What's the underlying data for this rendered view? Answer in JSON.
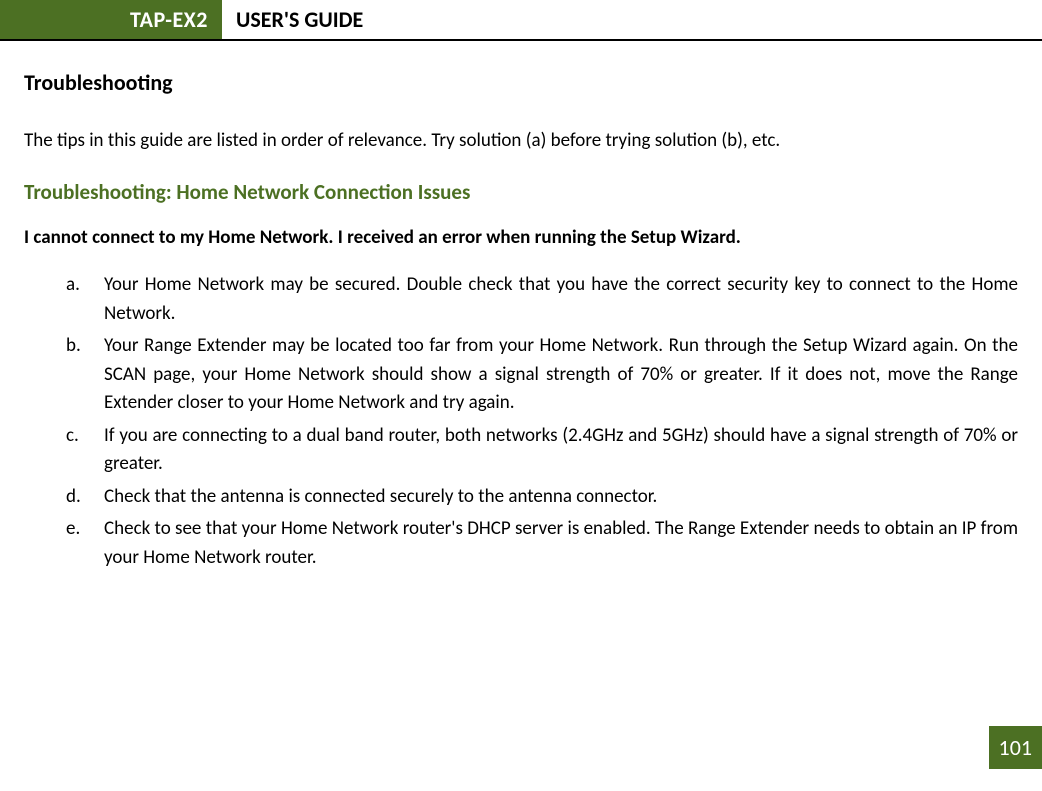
{
  "header": {
    "product": "TAP-EX2",
    "title": "USER'S GUIDE"
  },
  "page": {
    "heading": "Troubleshooting",
    "intro": "The tips in this guide are listed in order of relevance. Try solution (a) before trying solution (b), etc.",
    "subheading": "Troubleshooting: Home Network Connection Issues",
    "question": "I cannot connect to my Home Network. I received an error when running the Setup Wizard.",
    "answers": [
      {
        "marker": "a.",
        "text": "Your Home Network may be secured. Double check that you have the correct security key to connect to the Home Network."
      },
      {
        "marker": "b.",
        "text": "Your Range Extender may be located too far from your Home Network. Run through the Setup Wizard again. On the SCAN page, your Home Network should show a signal strength of 70% or greater. If it does not, move the Range Extender closer to your Home Network and try again."
      },
      {
        "marker": "c.",
        "text": "If you are connecting to a dual band router, both networks (2.4GHz and 5GHz) should have a signal strength of 70% or greater."
      },
      {
        "marker": "d.",
        "text": "Check that the antenna is connected securely to the antenna connector."
      },
      {
        "marker": "e.",
        "text": "Check to see that your Home Network router's DHCP server is enabled. The Range Extender needs to obtain an IP from your Home Network router."
      }
    ],
    "page_number": "101"
  }
}
